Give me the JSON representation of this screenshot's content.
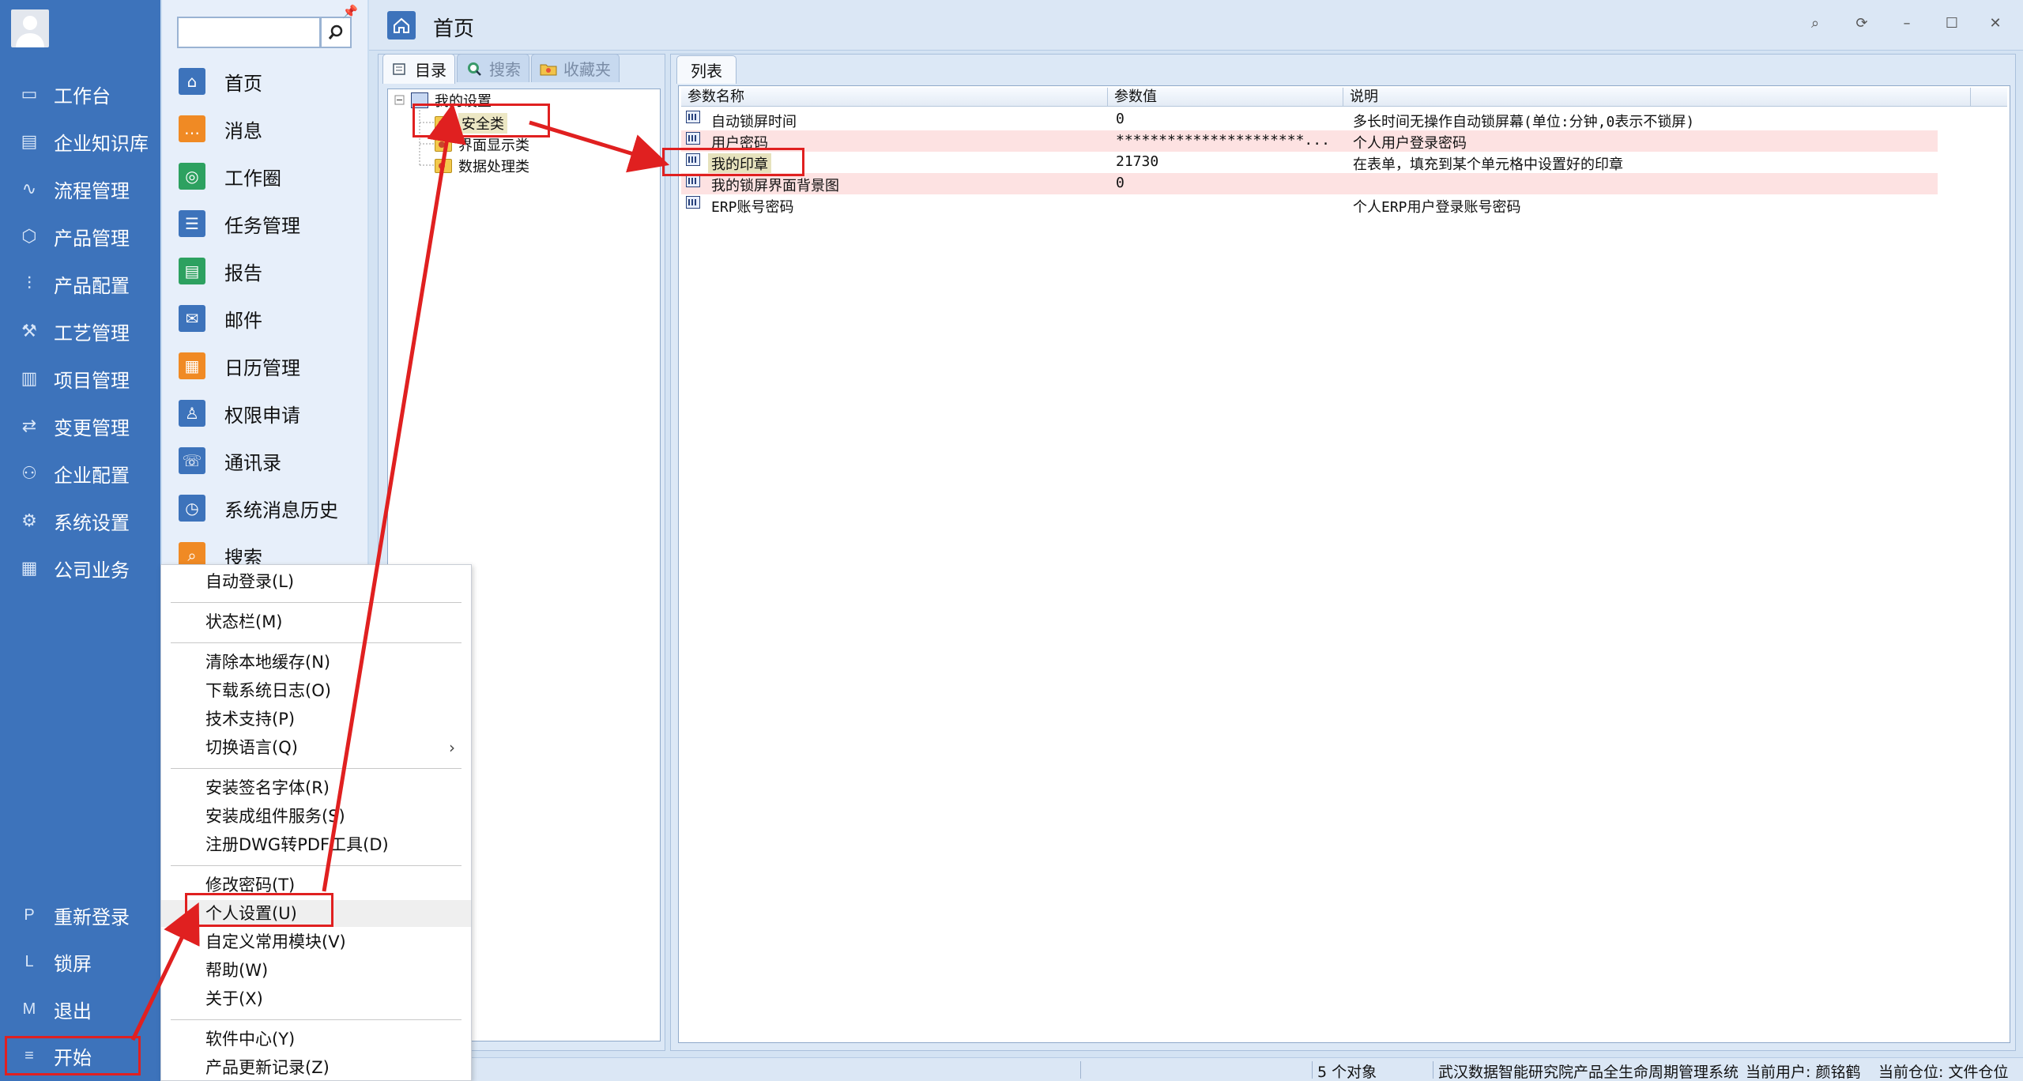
{
  "sidebar": {
    "items": [
      {
        "label": "工作台",
        "icon": "monitor-icon"
      },
      {
        "label": "企业知识库",
        "icon": "book-icon"
      },
      {
        "label": "流程管理",
        "icon": "flow-icon"
      },
      {
        "label": "产品管理",
        "icon": "cube-icon"
      },
      {
        "label": "产品配置",
        "icon": "sliders-icon"
      },
      {
        "label": "工艺管理",
        "icon": "wrench-icon"
      },
      {
        "label": "项目管理",
        "icon": "chart-icon"
      },
      {
        "label": "变更管理",
        "icon": "change-icon"
      },
      {
        "label": "企业配置",
        "icon": "users-icon"
      },
      {
        "label": "系统设置",
        "icon": "gear-icon"
      },
      {
        "label": "公司业务",
        "icon": "grid-icon"
      }
    ],
    "bottom": [
      {
        "key": "P",
        "label": "重新登录"
      },
      {
        "key": "L",
        "label": "锁屏"
      },
      {
        "key": "M",
        "label": "退出"
      },
      {
        "key": "≡",
        "label": "开始"
      }
    ]
  },
  "modules": {
    "search_placeholder": "",
    "items": [
      {
        "label": "首页",
        "color": "#3d73bb",
        "icon": "⌂"
      },
      {
        "label": "消息",
        "color": "#f08a24",
        "icon": "…"
      },
      {
        "label": "工作圈",
        "color": "#2da160",
        "icon": "◎"
      },
      {
        "label": "任务管理",
        "color": "#3d73bb",
        "icon": "☰"
      },
      {
        "label": "报告",
        "color": "#2da160",
        "icon": "▤"
      },
      {
        "label": "邮件",
        "color": "#3d73bb",
        "icon": "✉"
      },
      {
        "label": "日历管理",
        "color": "#f08a24",
        "icon": "▦"
      },
      {
        "label": "权限申请",
        "color": "#3d73bb",
        "icon": "♙"
      },
      {
        "label": "通讯录",
        "color": "#3d73bb",
        "icon": "☏"
      },
      {
        "label": "系统消息历史",
        "color": "#3d73bb",
        "icon": "◷"
      },
      {
        "label": "搜索",
        "color": "#f08a24",
        "icon": "⌕"
      }
    ]
  },
  "page": {
    "title": "首页"
  },
  "left_tabs": [
    {
      "label": "目录",
      "active": true
    },
    {
      "label": "搜索",
      "active": false
    },
    {
      "label": "收藏夹",
      "active": false
    }
  ],
  "tree": {
    "root": "我的设置",
    "children": [
      "安全类",
      "界面显示类",
      "数据处理类"
    ]
  },
  "right_tab": "列表",
  "grid": {
    "columns": [
      "参数名称",
      "参数值",
      "说明"
    ],
    "rows": [
      {
        "name": "自动锁屏时间",
        "value": "0",
        "desc": "多长时间无操作自动锁屏幕(单位:分钟,0表示不锁屏)",
        "highlight": false
      },
      {
        "name": "用户密码",
        "value": "**********************...",
        "desc": "个人用户登录密码",
        "highlight": true
      },
      {
        "name": "我的印章",
        "value": "21730",
        "desc": "在表单，填充到某个单元格中设置好的印章",
        "highlight": false
      },
      {
        "name": "我的锁屏界面背景图",
        "value": "0",
        "desc": "",
        "highlight": true
      },
      {
        "name": "ERP账号密码",
        "value": "",
        "desc": "个人ERP用户登录账号密码",
        "highlight": false
      }
    ]
  },
  "status": {
    "count": "5 个对象",
    "system": "武汉数据智能研究院产品全生命周期管理系统",
    "user": "当前用户: 颜铭鹤",
    "warehouse": "当前仓位: 文件仓位"
  },
  "context_menu": {
    "groups": [
      [
        "自动登录(L)"
      ],
      [
        "状态栏(M)"
      ],
      [
        "清除本地缓存(N)",
        "下载系统日志(O)",
        "技术支持(P)",
        "切换语言(Q)"
      ],
      [
        "安装签名字体(R)",
        "安装成组件服务(S)",
        "注册DWG转PDF工具(D)"
      ],
      [
        "修改密码(T)",
        "个人设置(U)",
        "自定义常用模块(V)",
        "帮助(W)",
        "关于(X)"
      ],
      [
        "软件中心(Y)",
        "产品更新记录(Z)"
      ]
    ],
    "submenu_item": "切换语言(Q)",
    "highlighted_item": "个人设置(U)"
  },
  "colors": {
    "sidebar": "#3d73bb",
    "annotation": "#e02020",
    "row_highlight": "#fde2e2"
  }
}
